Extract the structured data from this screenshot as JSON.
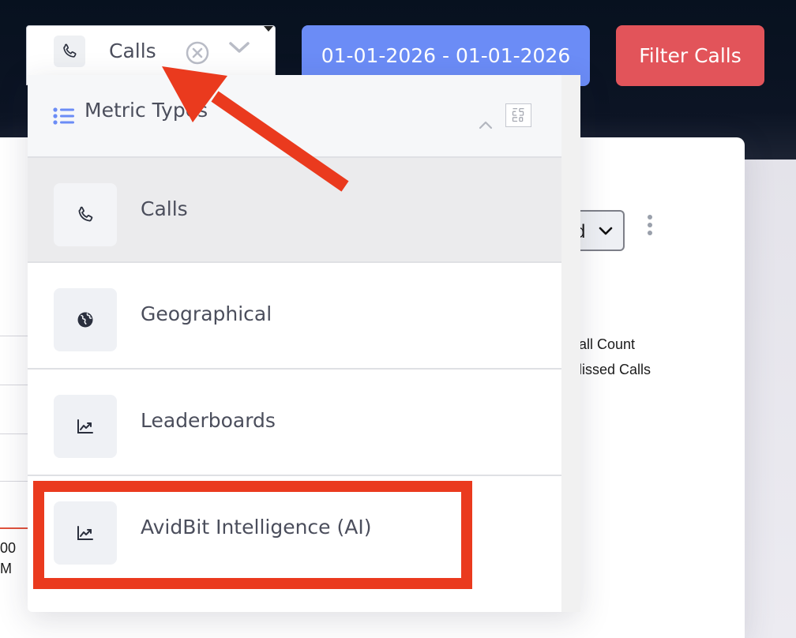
{
  "background": {
    "right_fragments": {
      "call_count": "all Count",
      "missed_calls": "lissed Calls",
      "select_fragment": "d"
    },
    "left_fragments": {
      "line1": "00",
      "line2": "M"
    }
  },
  "toolbar": {
    "metric_select": {
      "selected_label": "Calls",
      "icon": "phone-icon"
    },
    "date_range_label": "01-01-2026 - 01-01-2026",
    "filter_label": "Filter Calls"
  },
  "dropdown": {
    "title": "Metric Types",
    "items": [
      {
        "label": "Calls",
        "icon": "phone-icon",
        "active": true
      },
      {
        "label": "Geographical",
        "icon": "globe-icon",
        "active": false
      },
      {
        "label": "Leaderboards",
        "icon": "trending-up-icon",
        "active": false
      },
      {
        "label": "AvidBit Intelligence (AI)",
        "icon": "trending-up-icon",
        "active": false,
        "highlighted": true
      }
    ]
  },
  "colors": {
    "date_button": "#6b8cf6",
    "filter_button": "#e2545a",
    "annotation": "#ea3a1e",
    "header_background": "#07111f"
  }
}
